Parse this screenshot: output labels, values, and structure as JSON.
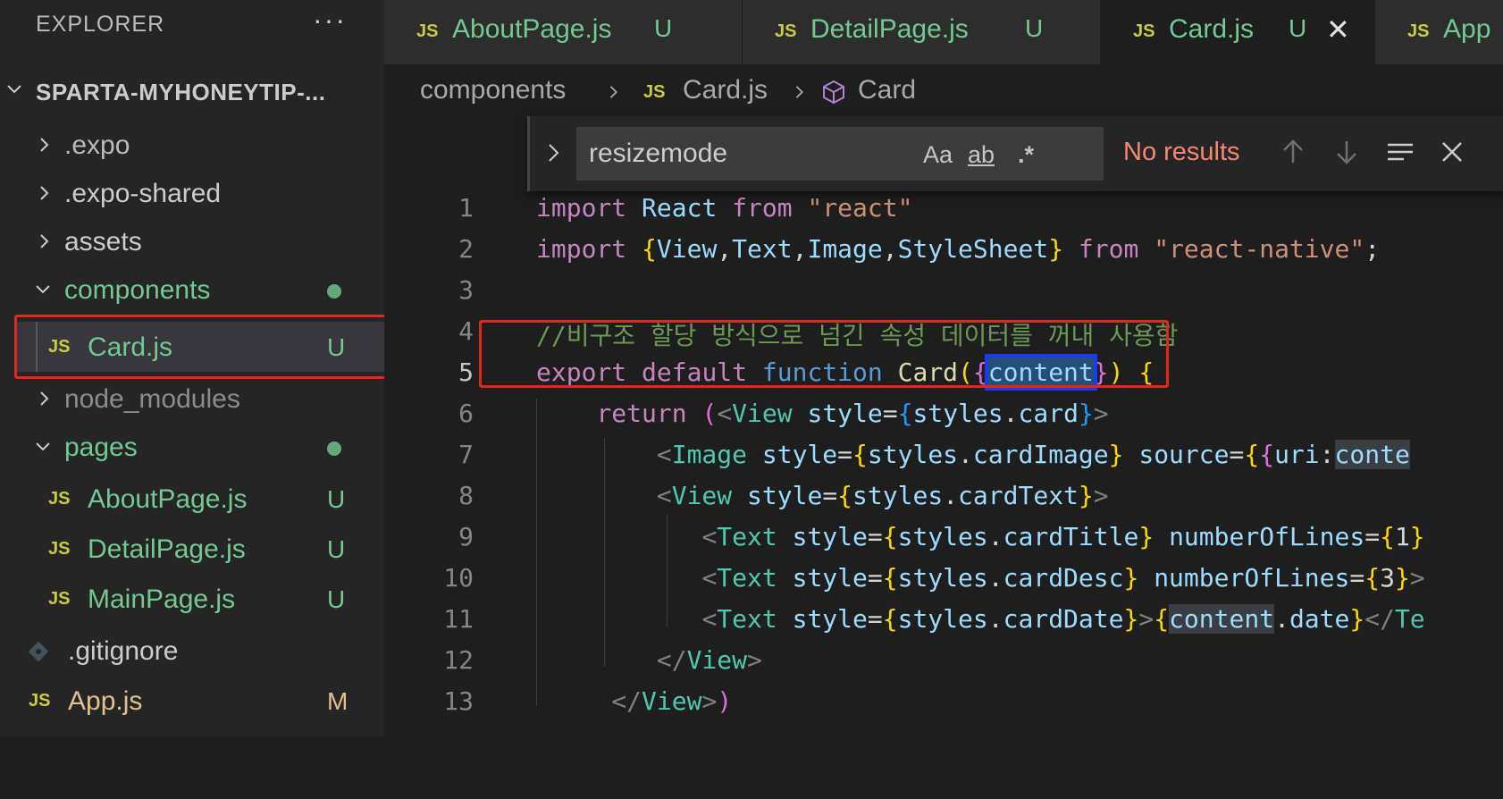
{
  "sidebar": {
    "title": "EXPLORER",
    "more": "···",
    "project": "SPARTA-MYHONEYTIP-...",
    "items": [
      {
        "label": ".expo",
        "type": "folder",
        "color": "#bbbbbb"
      },
      {
        "label": ".expo-shared",
        "type": "folder",
        "color": "#cccccc"
      },
      {
        "label": "assets",
        "type": "folder",
        "color": "#cccccc"
      },
      {
        "label": "components",
        "type": "folder-open",
        "color": "#73c991"
      },
      {
        "label": "Card.js",
        "type": "js",
        "status": "U",
        "color": "#73c991"
      },
      {
        "label": "node_modules",
        "type": "folder",
        "color": "#8c8c8c"
      },
      {
        "label": "pages",
        "type": "folder-open",
        "color": "#73c991"
      },
      {
        "label": "AboutPage.js",
        "type": "js",
        "status": "U",
        "color": "#73c991"
      },
      {
        "label": "DetailPage.js",
        "type": "js",
        "status": "U",
        "color": "#73c991"
      },
      {
        "label": "MainPage.js",
        "type": "js",
        "status": "U",
        "color": "#73c991"
      },
      {
        "label": ".gitignore",
        "type": "git",
        "color": "#cccccc"
      },
      {
        "label": "App.js",
        "type": "js",
        "status": "M",
        "color": "#e2c08d"
      }
    ]
  },
  "tabs": [
    {
      "js": "JS",
      "label": "AboutPage.js",
      "status": "U"
    },
    {
      "js": "JS",
      "label": "DetailPage.js",
      "status": "U"
    },
    {
      "js": "JS",
      "label": "Card.js",
      "status": "U",
      "close": "✕"
    },
    {
      "js": "JS",
      "label": "App"
    }
  ],
  "breadcrumb": {
    "folder": "components",
    "js": "JS",
    "file": "Card.js",
    "symbol": "Card"
  },
  "find": {
    "value": "resizemode",
    "match_case": "Aa",
    "whole_word": "ab",
    "regex": ".*",
    "status": "No results"
  },
  "code": {
    "line_numbers": [
      "1",
      "2",
      "3",
      "4",
      "5",
      "6",
      "7",
      "8",
      "9",
      "10",
      "11",
      "12",
      "13"
    ],
    "l1": {
      "a": "import",
      "b": "React",
      "c": "from",
      "d": "\"react\""
    },
    "l2": {
      "a": "import",
      "b": "{",
      "c": "View",
      "d": ",",
      "e": "Text",
      "f": ",",
      "g": "Image",
      "h": ",",
      "i": "StyleSheet",
      "j": "}",
      "k": "from",
      "l": "\"react-native\"",
      "m": ";"
    },
    "l4": {
      "a": "//비구조 할당 방식으로 넘긴 속성 데이터를 꺼내 사용함"
    },
    "l5": {
      "a": "export",
      "b": "default",
      "c": "function",
      "d": "Card",
      "e": "(",
      "f": "{",
      "g": "content",
      "h": "}",
      "i": ")",
      "j": "{"
    },
    "l6": {
      "a": "return",
      "b": "(",
      "c": "<",
      "d": "View",
      "e": "style",
      "f": "=",
      "g": "{",
      "h": "styles",
      "i": ".",
      "j": "card",
      "k": "}",
      "l": ">"
    },
    "l7": {
      "a": "<",
      "b": "Image",
      "c": "style",
      "d": "=",
      "e": "{",
      "f": "styles",
      "g": ".",
      "h": "cardImage",
      "i": "}",
      "j": "source",
      "k": "=",
      "l": "{",
      "m": "{",
      "n": "uri",
      "o": ":",
      "p": "conte"
    },
    "l8": {
      "a": "<",
      "b": "View",
      "c": "style",
      "d": "=",
      "e": "{",
      "f": "styles",
      "g": ".",
      "h": "cardText",
      "i": "}",
      "j": ">"
    },
    "l9": {
      "a": "<",
      "b": "Text",
      "c": "style",
      "d": "=",
      "e": "{",
      "f": "styles",
      "g": ".",
      "h": "cardTitle",
      "i": "}",
      "j": "numberOfLines",
      "k": "=",
      "l": "{",
      "m": "1",
      "n": "}"
    },
    "l10": {
      "a": "<",
      "b": "Text",
      "c": "style",
      "d": "=",
      "e": "{",
      "f": "styles",
      "g": ".",
      "h": "cardDesc",
      "i": "}",
      "j": "numberOfLines",
      "k": "=",
      "l": "{",
      "m": "3",
      "n": "}",
      "o": ">"
    },
    "l11": {
      "a": "<",
      "b": "Text",
      "c": "style",
      "d": "=",
      "e": "{",
      "f": "styles",
      "g": ".",
      "h": "cardDate",
      "i": "}",
      "j": ">",
      "k": "{",
      "l": "content",
      "m": ".",
      "n": "date",
      "o": "}",
      "p": "</",
      "q": "Te"
    },
    "l12": {
      "a": "</",
      "b": "View",
      "c": ">"
    },
    "l13": {
      "a": "</",
      "b": "View",
      "c": ">",
      "d": ")"
    }
  },
  "colors": {
    "accent_red": "#e0281c",
    "selection_blue": "#1a3cf0",
    "git_untracked": "#73c991",
    "git_modified": "#e2c08d"
  }
}
